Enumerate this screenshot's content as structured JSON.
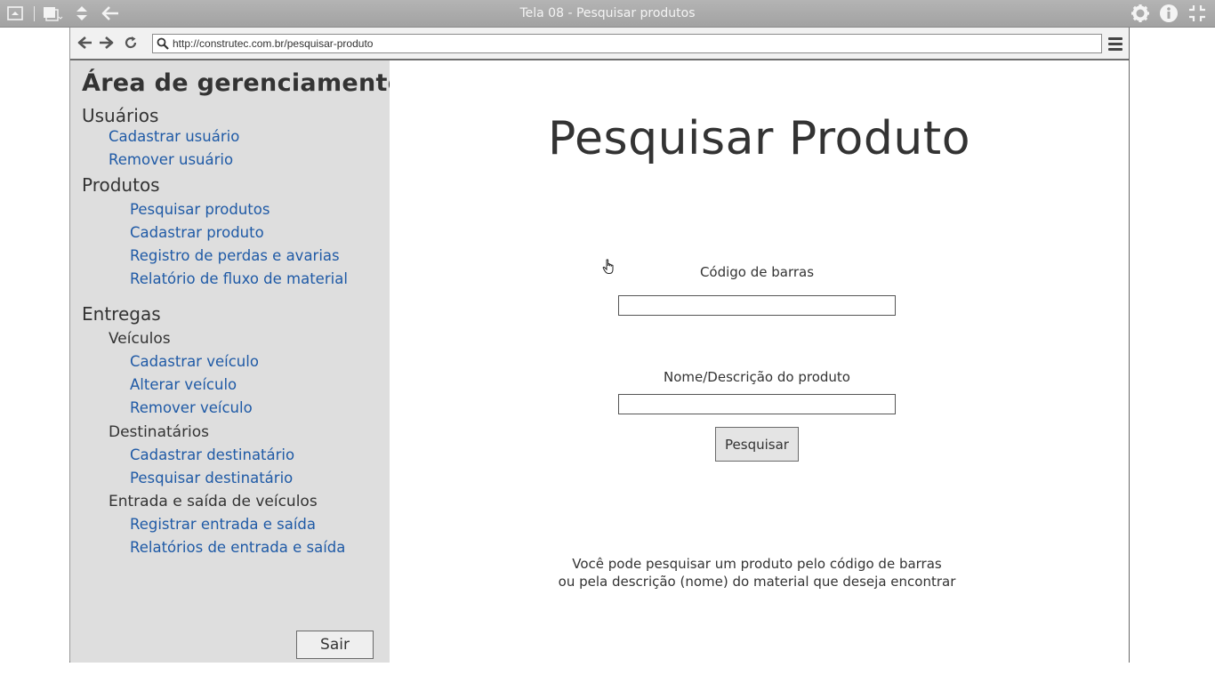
{
  "window": {
    "title": "Tela 08 - Pesquisar produtos"
  },
  "browser": {
    "url": "http://construtec.com.br/pesquisar-produto"
  },
  "sidebar": {
    "title": "Área de gerenciamento",
    "usuarios": {
      "heading": "Usuários",
      "links": [
        "Cadastrar usuário",
        "Remover usuário"
      ]
    },
    "produtos": {
      "heading": "Produtos",
      "links": [
        "Pesquisar produtos",
        "Cadastrar produto",
        "Registro de perdas e avarias",
        "Relatório de fluxo de material"
      ]
    },
    "entregas": {
      "heading": "Entregas",
      "veiculos": {
        "heading": "Veículos",
        "links": [
          "Cadastrar veículo",
          "Alterar veículo",
          "Remover veículo"
        ]
      },
      "destinatarios": {
        "heading": "Destinatários",
        "links": [
          "Cadastrar destinatário",
          "Pesquisar destinatário"
        ]
      },
      "entrada_saida": {
        "heading": "Entrada e saída de veículos",
        "links": [
          "Registrar entrada e saída",
          "Relatórios de entrada e saída"
        ]
      }
    },
    "logout_label": "Sair"
  },
  "main": {
    "title": "Pesquisar Produto",
    "barcode_label": "Código de barras",
    "barcode_value": "",
    "description_label": "Nome/Descrição do produto",
    "description_value": "",
    "search_label": "Pesquisar",
    "help_line1": "Você pode pesquisar um produto pelo código de barras",
    "help_line2": "ou pela descrição (nome) do material que deseja encontrar"
  },
  "colors": {
    "link": "#1f5aa6",
    "sidebar_bg": "#dedede",
    "titlebar_bg": "#a8a8a8"
  }
}
